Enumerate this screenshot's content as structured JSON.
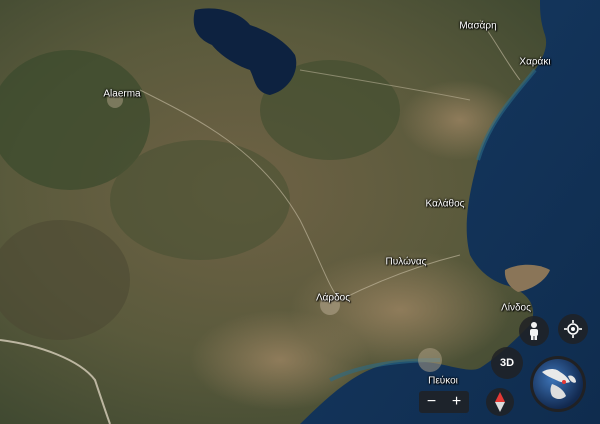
{
  "map": {
    "view": "satellite",
    "labels": [
      {
        "id": "massari",
        "text": "Μασάρη"
      },
      {
        "id": "charaki",
        "text": "Χαράκι"
      },
      {
        "id": "alaerma",
        "text": "Alaerma"
      },
      {
        "id": "kalathos",
        "text": "Καλάθος"
      },
      {
        "id": "pylona",
        "text": "Πυλώνας"
      },
      {
        "id": "lardos",
        "text": "Λάρδος"
      },
      {
        "id": "lindos",
        "text": "Λίνδος"
      },
      {
        "id": "pefkoi",
        "text": "Πεύκοι"
      }
    ]
  },
  "controls": {
    "three_d_label": "3D",
    "zoom_out_label": "−",
    "zoom_in_label": "+",
    "icons": [
      "pegman-icon",
      "my-location-icon",
      "compass-icon",
      "globe-icon"
    ]
  }
}
